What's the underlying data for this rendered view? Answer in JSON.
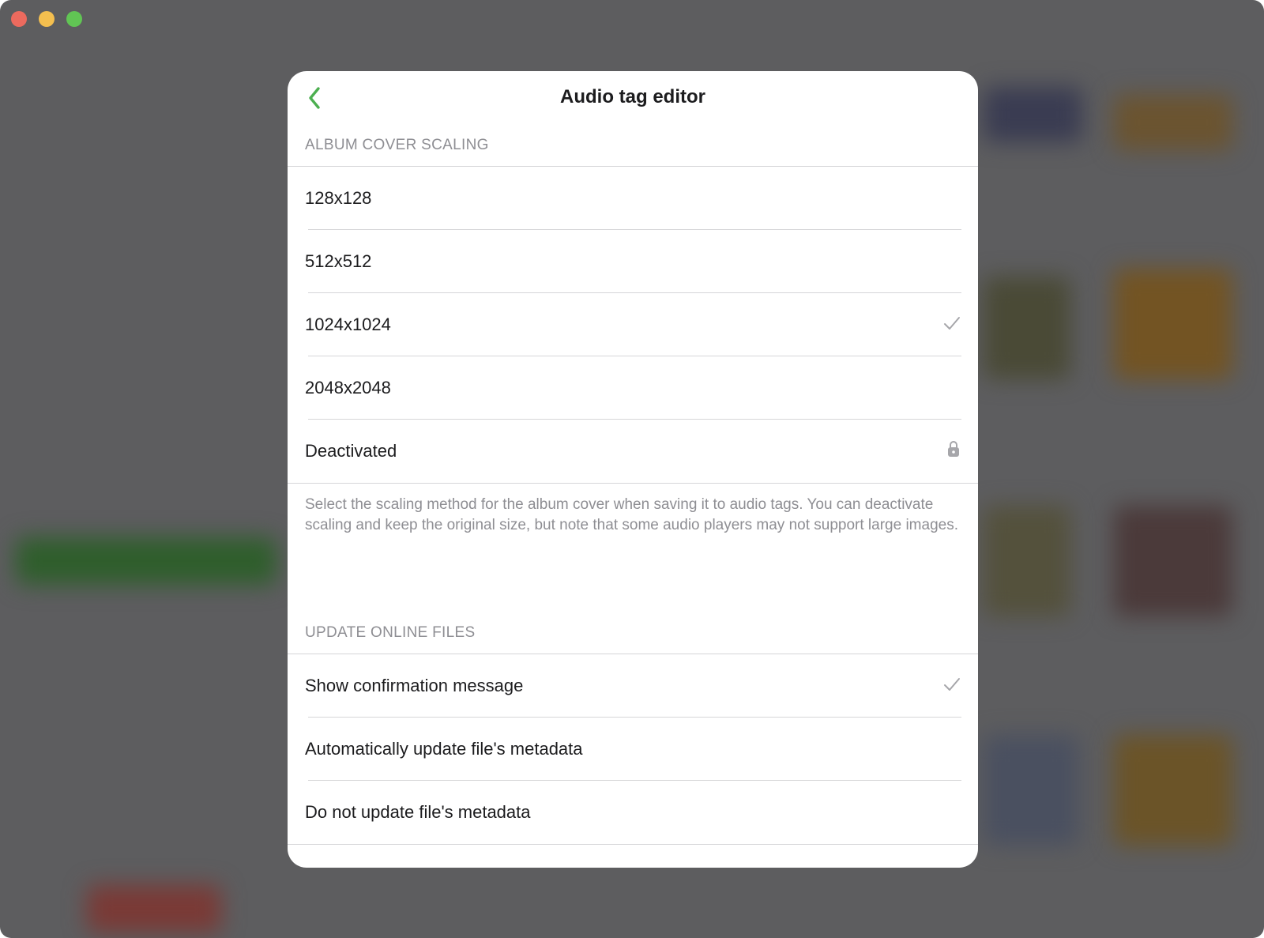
{
  "dialog": {
    "title": "Audio tag editor",
    "accent_color": "#4caf50"
  },
  "scaling": {
    "header": "ALBUM COVER SCALING",
    "options": [
      {
        "label": "128x128",
        "checked": false,
        "locked": false
      },
      {
        "label": "512x512",
        "checked": false,
        "locked": false
      },
      {
        "label": "1024x1024",
        "checked": true,
        "locked": false
      },
      {
        "label": "2048x2048",
        "checked": false,
        "locked": false
      },
      {
        "label": "Deactivated",
        "checked": false,
        "locked": true
      }
    ],
    "footer": "Select the scaling method for the album cover when saving it to audio tags. You can deactivate scaling and keep the original size, but note that some audio players may not support large images."
  },
  "online": {
    "header": "UPDATE ONLINE FILES",
    "options": [
      {
        "label": "Show confirmation message",
        "checked": true
      },
      {
        "label": "Automatically update file's metadata",
        "checked": false
      },
      {
        "label": "Do not update file's metadata",
        "checked": false
      }
    ]
  }
}
